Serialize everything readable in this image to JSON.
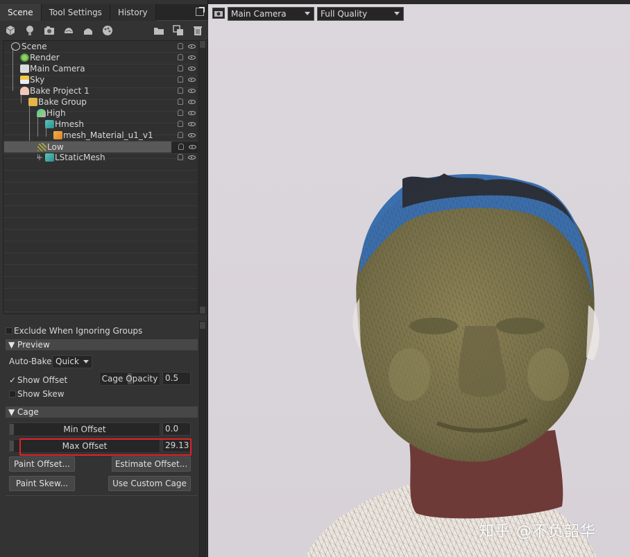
{
  "tabs": {
    "scene": "Scene",
    "tool_settings": "Tool Settings",
    "history": "History"
  },
  "tree": [
    {
      "label": "Scene",
      "icon": "scene-icon"
    },
    {
      "label": "Render",
      "icon": "gear-icon"
    },
    {
      "label": "Main Camera",
      "icon": "camera-icon"
    },
    {
      "label": "Sky",
      "icon": "sky-icon"
    },
    {
      "label": "Bake Project 1",
      "icon": "bake-project-icon"
    },
    {
      "label": "Bake Group",
      "icon": "folder-icon"
    },
    {
      "label": "High",
      "icon": "high-icon"
    },
    {
      "label": "Hmesh",
      "icon": "mesh-icon"
    },
    {
      "label": "mesh_Material_u1_v1",
      "icon": "submesh-icon"
    },
    {
      "label": "Low",
      "icon": "low-icon"
    },
    {
      "label": "LStaticMesh",
      "icon": "mesh-icon"
    }
  ],
  "props": {
    "exclude_label": "Exclude When Ignoring Groups",
    "preview_header": "Preview",
    "autobake_label": "Auto-Bake",
    "autobake_value": "Quick",
    "show_offset": "Show Offset",
    "cage_opacity_label": "Cage Opacity",
    "cage_opacity_value": "0.5",
    "show_skew": "Show Skew",
    "cage_header": "Cage",
    "min_offset_label": "Min Offset",
    "min_offset_value": "0.0",
    "max_offset_label": "Max Offset",
    "max_offset_value": "29.13",
    "paint_offset": "Paint Offset...",
    "estimate_offset": "Estimate Offset...",
    "paint_skew": "Paint Skew...",
    "use_custom_cage": "Use Custom Cage"
  },
  "viewport": {
    "camera": "Main Camera",
    "quality": "Full Quality",
    "watermark": "知乎 @不负韶华"
  },
  "colors": {
    "highlight_box": "#e0232a",
    "mesh_blue": "#3a6fb0",
    "mesh_olive": "#7d7650",
    "neck": "#6e3a38"
  }
}
